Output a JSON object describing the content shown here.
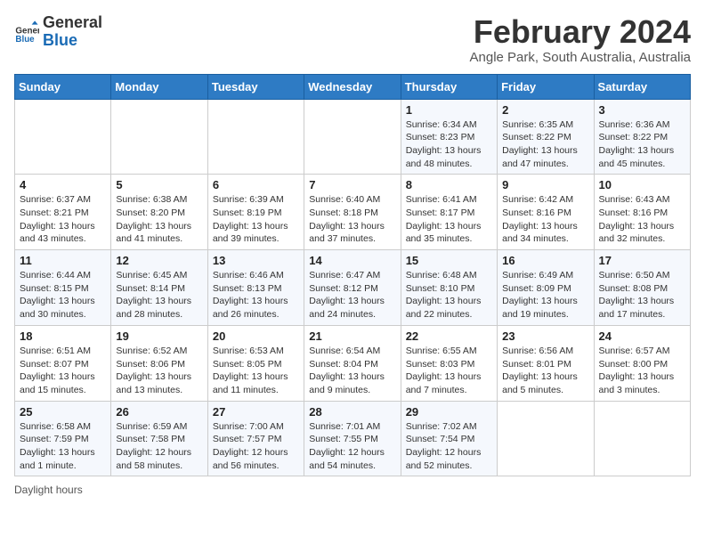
{
  "header": {
    "logo_general": "General",
    "logo_blue": "Blue",
    "month_year": "February 2024",
    "location": "Angle Park, South Australia, Australia"
  },
  "days_of_week": [
    "Sunday",
    "Monday",
    "Tuesday",
    "Wednesday",
    "Thursday",
    "Friday",
    "Saturday"
  ],
  "weeks": [
    [
      {
        "num": "",
        "info": ""
      },
      {
        "num": "",
        "info": ""
      },
      {
        "num": "",
        "info": ""
      },
      {
        "num": "",
        "info": ""
      },
      {
        "num": "1",
        "info": "Sunrise: 6:34 AM\nSunset: 8:23 PM\nDaylight: 13 hours and 48 minutes."
      },
      {
        "num": "2",
        "info": "Sunrise: 6:35 AM\nSunset: 8:22 PM\nDaylight: 13 hours and 47 minutes."
      },
      {
        "num": "3",
        "info": "Sunrise: 6:36 AM\nSunset: 8:22 PM\nDaylight: 13 hours and 45 minutes."
      }
    ],
    [
      {
        "num": "4",
        "info": "Sunrise: 6:37 AM\nSunset: 8:21 PM\nDaylight: 13 hours and 43 minutes."
      },
      {
        "num": "5",
        "info": "Sunrise: 6:38 AM\nSunset: 8:20 PM\nDaylight: 13 hours and 41 minutes."
      },
      {
        "num": "6",
        "info": "Sunrise: 6:39 AM\nSunset: 8:19 PM\nDaylight: 13 hours and 39 minutes."
      },
      {
        "num": "7",
        "info": "Sunrise: 6:40 AM\nSunset: 8:18 PM\nDaylight: 13 hours and 37 minutes."
      },
      {
        "num": "8",
        "info": "Sunrise: 6:41 AM\nSunset: 8:17 PM\nDaylight: 13 hours and 35 minutes."
      },
      {
        "num": "9",
        "info": "Sunrise: 6:42 AM\nSunset: 8:16 PM\nDaylight: 13 hours and 34 minutes."
      },
      {
        "num": "10",
        "info": "Sunrise: 6:43 AM\nSunset: 8:16 PM\nDaylight: 13 hours and 32 minutes."
      }
    ],
    [
      {
        "num": "11",
        "info": "Sunrise: 6:44 AM\nSunset: 8:15 PM\nDaylight: 13 hours and 30 minutes."
      },
      {
        "num": "12",
        "info": "Sunrise: 6:45 AM\nSunset: 8:14 PM\nDaylight: 13 hours and 28 minutes."
      },
      {
        "num": "13",
        "info": "Sunrise: 6:46 AM\nSunset: 8:13 PM\nDaylight: 13 hours and 26 minutes."
      },
      {
        "num": "14",
        "info": "Sunrise: 6:47 AM\nSunset: 8:12 PM\nDaylight: 13 hours and 24 minutes."
      },
      {
        "num": "15",
        "info": "Sunrise: 6:48 AM\nSunset: 8:10 PM\nDaylight: 13 hours and 22 minutes."
      },
      {
        "num": "16",
        "info": "Sunrise: 6:49 AM\nSunset: 8:09 PM\nDaylight: 13 hours and 19 minutes."
      },
      {
        "num": "17",
        "info": "Sunrise: 6:50 AM\nSunset: 8:08 PM\nDaylight: 13 hours and 17 minutes."
      }
    ],
    [
      {
        "num": "18",
        "info": "Sunrise: 6:51 AM\nSunset: 8:07 PM\nDaylight: 13 hours and 15 minutes."
      },
      {
        "num": "19",
        "info": "Sunrise: 6:52 AM\nSunset: 8:06 PM\nDaylight: 13 hours and 13 minutes."
      },
      {
        "num": "20",
        "info": "Sunrise: 6:53 AM\nSunset: 8:05 PM\nDaylight: 13 hours and 11 minutes."
      },
      {
        "num": "21",
        "info": "Sunrise: 6:54 AM\nSunset: 8:04 PM\nDaylight: 13 hours and 9 minutes."
      },
      {
        "num": "22",
        "info": "Sunrise: 6:55 AM\nSunset: 8:03 PM\nDaylight: 13 hours and 7 minutes."
      },
      {
        "num": "23",
        "info": "Sunrise: 6:56 AM\nSunset: 8:01 PM\nDaylight: 13 hours and 5 minutes."
      },
      {
        "num": "24",
        "info": "Sunrise: 6:57 AM\nSunset: 8:00 PM\nDaylight: 13 hours and 3 minutes."
      }
    ],
    [
      {
        "num": "25",
        "info": "Sunrise: 6:58 AM\nSunset: 7:59 PM\nDaylight: 13 hours and 1 minute."
      },
      {
        "num": "26",
        "info": "Sunrise: 6:59 AM\nSunset: 7:58 PM\nDaylight: 12 hours and 58 minutes."
      },
      {
        "num": "27",
        "info": "Sunrise: 7:00 AM\nSunset: 7:57 PM\nDaylight: 12 hours and 56 minutes."
      },
      {
        "num": "28",
        "info": "Sunrise: 7:01 AM\nSunset: 7:55 PM\nDaylight: 12 hours and 54 minutes."
      },
      {
        "num": "29",
        "info": "Sunrise: 7:02 AM\nSunset: 7:54 PM\nDaylight: 12 hours and 52 minutes."
      },
      {
        "num": "",
        "info": ""
      },
      {
        "num": "",
        "info": ""
      }
    ]
  ],
  "legend": {
    "daylight_hours": "Daylight hours"
  }
}
